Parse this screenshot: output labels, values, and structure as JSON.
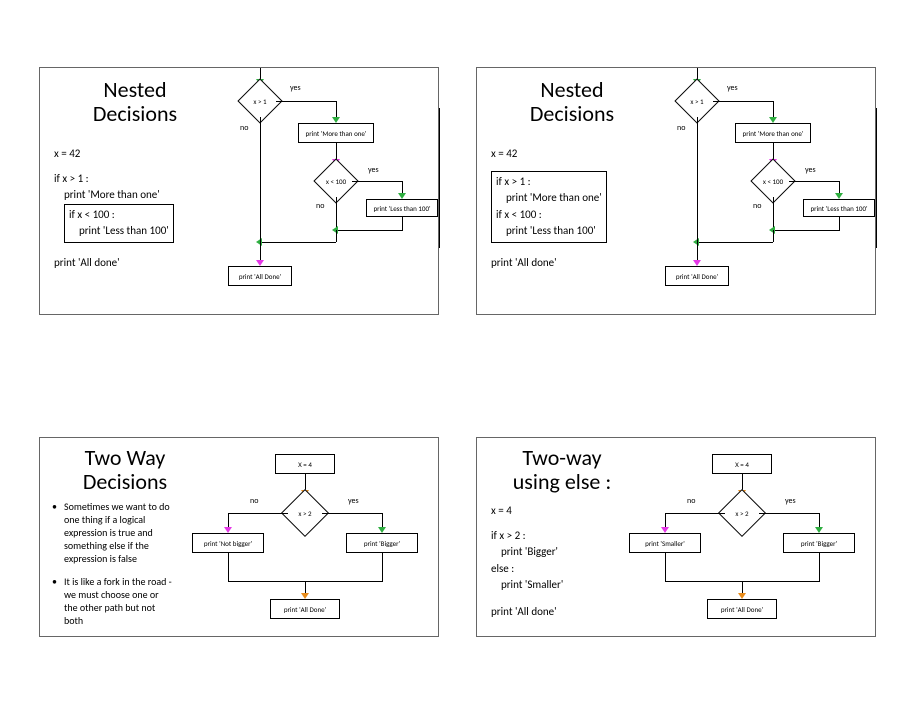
{
  "slides": [
    {
      "title": "Nested\nDecisions",
      "code": {
        "l1": "x = 42",
        "l2": "if x > 1 :",
        "l3": "    print 'More than one'",
        "box1": "if x < 100 :",
        "box2": "    print 'Less than 100'",
        "l6": "print 'All done'"
      },
      "flow": {
        "d1": "x > 1",
        "d2": "x < 100",
        "b1": "print 'More than one'",
        "b2": "print 'Less than 100'",
        "b3": "print 'All Done'",
        "yes": "yes",
        "no": "no"
      }
    },
    {
      "title": "Nested\nDecisions",
      "code": {
        "l1": "x = 42",
        "l2": "if x > 1 :",
        "l3": "    print 'More than one'",
        "l4": "if x < 100 :",
        "l5": "    print 'Less than 100'",
        "l6": "print 'All done'"
      },
      "flow": {
        "d1": "x > 1",
        "d2": "x < 100",
        "b1": "print 'More than one'",
        "b2": "print 'Less than 100'",
        "b3": "print 'All Done'",
        "yes": "yes",
        "no": "no"
      }
    },
    {
      "title": "Two Way\nDecisions",
      "bullets": [
        "Sometimes we want to do one thing if a logical expression is true and something else if the expression is false",
        "It is like a fork in the road - we must choose one or the other path but not both"
      ],
      "flow": {
        "b0": "X = 4",
        "d1": "x > 2",
        "bL": "print 'Not bigger'",
        "bR": "print 'Bigger'",
        "b3": "print 'All Done'",
        "yes": "yes",
        "no": "no"
      }
    },
    {
      "title": "Two-way\nusing else :",
      "code": {
        "l1": "x = 4",
        "l2": "if x > 2 :",
        "l3": "    print 'Bigger'",
        "l4": "else :",
        "l5": "    print 'Smaller'",
        "l6": "print 'All done'"
      },
      "flow": {
        "b0": "X = 4",
        "d1": "x > 2",
        "bL": "print 'Smaller'",
        "bR": "print 'Bigger'",
        "b3": "print 'All Done'",
        "yes": "yes",
        "no": "no"
      }
    }
  ]
}
